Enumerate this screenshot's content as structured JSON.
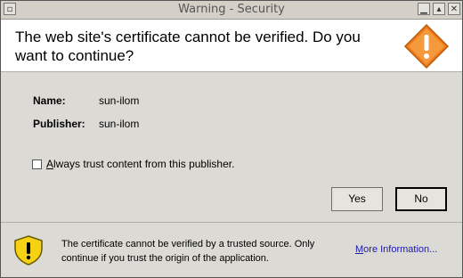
{
  "window": {
    "title": "Warning - Security"
  },
  "titlebar_buttons": {
    "menu": "▫",
    "minimize": "▁",
    "maximize": "▴",
    "close": "✕"
  },
  "header": {
    "message": "The web site's certificate cannot be verified.  Do you want to continue?",
    "icon": "warning-diamond-icon"
  },
  "details": {
    "name_label": "Name:",
    "name_value": "sun-ilom",
    "publisher_label": "Publisher:",
    "publisher_value": "sun-ilom"
  },
  "trust": {
    "label_first": "A",
    "label_rest": "lways trust content from this publisher.",
    "checked": false
  },
  "buttons": {
    "yes": "Yes",
    "no": "No"
  },
  "footer": {
    "icon": "shield-warning-icon",
    "note": "The certificate cannot be verified by a trusted source.  Only continue if you trust the origin of the application.",
    "more_first": "M",
    "more_rest": "ore Information..."
  },
  "colors": {
    "warning_orange": "#f07c1c",
    "shield_yellow": "#f5d314",
    "link": "#1a1ab0"
  }
}
